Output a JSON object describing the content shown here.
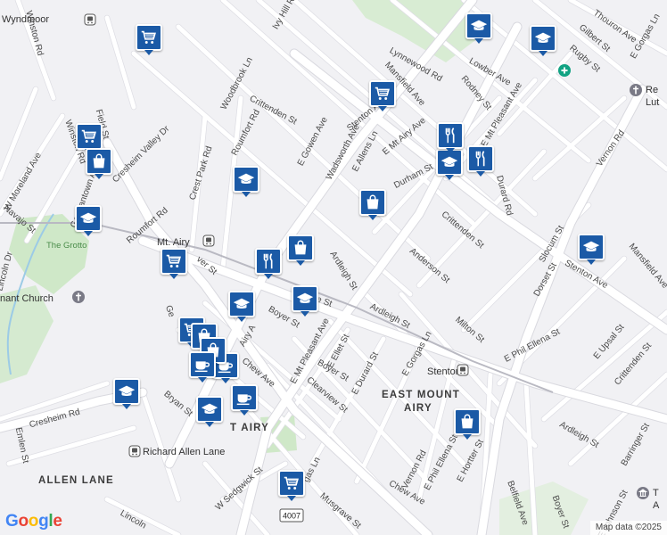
{
  "map": {
    "attribution": "Map data ©2025",
    "logo": "Google",
    "route_badge": "4007"
  },
  "areas": [
    {
      "id": "allen-lane",
      "text": "ALLEN LANE"
    },
    {
      "id": "east-mount-airy-1",
      "text": "EAST MOUNT"
    },
    {
      "id": "east-mount-airy-2",
      "text": "AIRY"
    },
    {
      "id": "mt-airy-partial",
      "text": "T AIRY"
    }
  ],
  "places": [
    {
      "id": "wyndmoor",
      "text": "Wyndmoor"
    },
    {
      "id": "mt-airy-station",
      "text": "Mt. Airy"
    },
    {
      "id": "stenton-station",
      "text": "Stenton"
    },
    {
      "id": "richard-allen-lane",
      "text": "Richard Allen Lane"
    },
    {
      "id": "the-grotto",
      "text": "The Grotto"
    },
    {
      "id": "church",
      "text": "nant Church"
    },
    {
      "id": "re-lut-1",
      "text": "Re"
    },
    {
      "id": "re-lut-2",
      "text": "Lut"
    },
    {
      "id": "t-a-1",
      "text": "T"
    },
    {
      "id": "t-a-2",
      "text": "A"
    }
  ],
  "streets": [
    {
      "id": "winston-rd",
      "text": "Winston Rd"
    },
    {
      "id": "ivy-hill-rd",
      "text": "Ivy Hill Rd"
    },
    {
      "id": "woodbrook-ln",
      "text": "Woodbrook Ln"
    },
    {
      "id": "crittenden-st-1",
      "text": "Crittenden St"
    },
    {
      "id": "roumfort-rd-1",
      "text": "Roumfort Rd"
    },
    {
      "id": "e-gowen-ave",
      "text": "E Gowen Ave"
    },
    {
      "id": "wadsworth-ave",
      "text": "Wadsworth Ave"
    },
    {
      "id": "e-allens-ln",
      "text": "E Allens Ln"
    },
    {
      "id": "stenton-ave-1",
      "text": "Stenton Ave"
    },
    {
      "id": "mansfield-ave-1",
      "text": "Mansfield Ave"
    },
    {
      "id": "lynnewood-rd",
      "text": "Lynnewood Rd"
    },
    {
      "id": "e-mt-airy-ave",
      "text": "E Mt Airy Ave"
    },
    {
      "id": "durham-st",
      "text": "Durham St"
    },
    {
      "id": "rodney-st",
      "text": "Rodney St"
    },
    {
      "id": "lowber-ave",
      "text": "Lowber Ave"
    },
    {
      "id": "e-mt-pleasant-ave-1",
      "text": "E Mt Pleasant Ave"
    },
    {
      "id": "gilbert-st",
      "text": "Gilbert St"
    },
    {
      "id": "rugby-st",
      "text": "Rugby St"
    },
    {
      "id": "thouron-ave",
      "text": "Thouron Ave"
    },
    {
      "id": "e-gorgas-ln-1",
      "text": "E Gorgas Ln"
    },
    {
      "id": "vernon-rd-1",
      "text": "Vernon Rd"
    },
    {
      "id": "durard-rd",
      "text": "Durard Rd"
    },
    {
      "id": "crittenden-st-2",
      "text": "Crittenden St"
    },
    {
      "id": "slocum-st",
      "text": "Slocum St"
    },
    {
      "id": "dorset-st",
      "text": "Dorset St"
    },
    {
      "id": "stenton-ave-2",
      "text": "Stenton Ave"
    },
    {
      "id": "mansfield-ave-2",
      "text": "Mansfield Ave"
    },
    {
      "id": "anderson-st",
      "text": "Anderson St"
    },
    {
      "id": "ardleigh-st-1",
      "text": "Ardleigh St"
    },
    {
      "id": "ardleigh-st-2",
      "text": "Ardleigh St"
    },
    {
      "id": "milton-st",
      "text": "Milton St"
    },
    {
      "id": "e-phil-ellena-st-1",
      "text": "E Phil Ellena St"
    },
    {
      "id": "e-upsal-st",
      "text": "E Upsal St"
    },
    {
      "id": "crittenden-st-3",
      "text": "Crittenden St"
    },
    {
      "id": "ardleigh-st-3",
      "text": "Ardleigh St"
    },
    {
      "id": "barringer-st",
      "text": "Barringer St"
    },
    {
      "id": "e-gorgas-ln-2",
      "text": "E Gorgas Ln"
    },
    {
      "id": "e-durard-st",
      "text": "E Durard St"
    },
    {
      "id": "e-ellet-st",
      "text": "E Ellet St"
    },
    {
      "id": "boyer-st-1",
      "text": "Boyer St"
    },
    {
      "id": "boyer-st-2",
      "text": "Boyer St"
    },
    {
      "id": "clearview-st",
      "text": "Clearview St"
    },
    {
      "id": "e-mt-pleasant-ave-2",
      "text": "E Mt Pleasant Ave"
    },
    {
      "id": "chew-ave-1",
      "text": "Chew Ave"
    },
    {
      "id": "chew-ave-2",
      "text": "Chew Ave"
    },
    {
      "id": "vernon-rd-2",
      "text": "Vernon Rd"
    },
    {
      "id": "e-phil-ellena-st-2",
      "text": "E Phil Ellena St"
    },
    {
      "id": "e-hortter-st",
      "text": "E Hortter St"
    },
    {
      "id": "belfield-ave",
      "text": "Belfield Ave"
    },
    {
      "id": "boyer-st-3",
      "text": "Boyer St"
    },
    {
      "id": "e-johnson-st",
      "text": "E Johnson St"
    },
    {
      "id": "musgrave-st",
      "text": "Musgrave St"
    },
    {
      "id": "gorgas-ln",
      "text": "gas Ln"
    },
    {
      "id": "w-sedgwick-st",
      "text": "W Sedgwick St"
    },
    {
      "id": "lincoln-dr-1",
      "text": "Lincoln"
    },
    {
      "id": "emlen-st",
      "text": "Emlen St"
    },
    {
      "id": "cresheim-rd",
      "text": "Cresheim Rd"
    },
    {
      "id": "bryan-st",
      "text": "Bryan St"
    },
    {
      "id": "cresheim-valley-dr",
      "text": "Cresheim Valley Dr"
    },
    {
      "id": "germantown-ave",
      "text": "Germantown Ave"
    },
    {
      "id": "roumfort-rd-2",
      "text": "Roumfort Rd"
    },
    {
      "id": "crest-park-rd",
      "text": "Crest Park Rd"
    },
    {
      "id": "w-moreland-ave",
      "text": "W Moreland Ave"
    },
    {
      "id": "navajo-st",
      "text": "Navajo St"
    },
    {
      "id": "lincoln-dr-2",
      "text": "Lincoln Dr"
    },
    {
      "id": "winston-ln",
      "text": "Winston Rd"
    },
    {
      "id": "field-st",
      "text": "field St"
    },
    {
      "id": "edgemont",
      "text": "Field St"
    },
    {
      "id": "ardleigh-st-4",
      "text": "Ardleigh St"
    },
    {
      "id": "e-mt-pleasant-ave-3",
      "text": "E Mt Pleasant Ave"
    },
    {
      "id": "ellet",
      "text": "ne St"
    },
    {
      "id": "s-label",
      "text": "S"
    },
    {
      "id": "hew-ave",
      "text": "hew Ave"
    },
    {
      "id": "ge-label",
      "text": "Ge"
    },
    {
      "id": "ver-st",
      "text": "ver St"
    },
    {
      "id": "ainh",
      "text": "Airy A"
    }
  ],
  "pois": [
    {
      "id": "grocery",
      "icon": "cart-icon"
    },
    {
      "id": "school",
      "icon": "school-icon"
    },
    {
      "id": "store",
      "icon": "shopping-bag-icon"
    },
    {
      "id": "restaurant",
      "icon": "fork-knife-icon"
    },
    {
      "id": "cafe",
      "icon": "coffee-cup-icon"
    }
  ],
  "colors": {
    "background": "#f1f1f4",
    "poi": "#1b5aa6",
    "park": "#cfe8c8",
    "water": "#9ccbe6",
    "road": "#ffffff"
  }
}
